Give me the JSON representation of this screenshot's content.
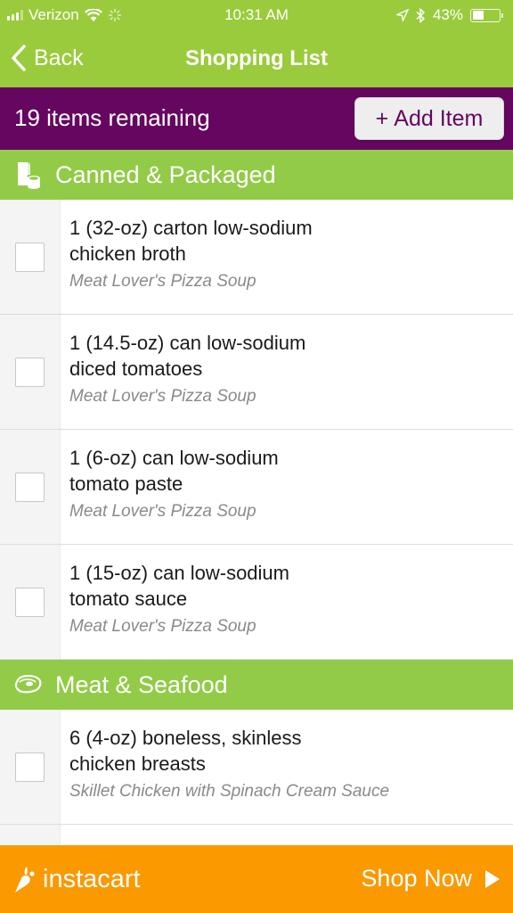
{
  "status_bar": {
    "carrier": "Verizon",
    "time": "10:31 AM",
    "battery_percent": "43%",
    "battery_level": 0.43
  },
  "nav": {
    "back_label": "Back",
    "title": "Shopping List"
  },
  "summary": {
    "remaining_text": "19 items remaining",
    "add_item_label": "Add Item",
    "add_item_icon": "+"
  },
  "sections": [
    {
      "title": "Canned & Packaged",
      "icon": "canned-goods-icon",
      "items": [
        {
          "line1": "1  (32-oz) carton low-sodium",
          "line2": "chicken broth",
          "recipe": "Meat Lover's Pizza Soup",
          "checked": false
        },
        {
          "line1": "1 (14.5-oz) can low-sodium",
          "line2": "diced tomatoes",
          "recipe": "Meat Lover's Pizza Soup",
          "checked": false
        },
        {
          "line1": "1 (6-oz) can low-sodium",
          "line2": "tomato paste",
          "recipe": "Meat Lover's Pizza Soup",
          "checked": false
        },
        {
          "line1": "1 (15-oz) can low-sodium",
          "line2": "tomato sauce",
          "recipe": "Meat Lover's Pizza Soup",
          "checked": false
        }
      ]
    },
    {
      "title": "Meat & Seafood",
      "icon": "steak-icon",
      "items": [
        {
          "line1": "6  (4-oz) boneless, skinless",
          "line2": "chicken breasts",
          "recipe": "Skillet Chicken with Spinach Cream Sauce",
          "checked": false
        }
      ]
    }
  ],
  "footer": {
    "brand": "instacart",
    "cta_label": "Shop Now"
  },
  "colors": {
    "nav_green": "#9acb3c",
    "section_green": "#92cb47",
    "purple": "#650660",
    "orange": "#fa9900"
  }
}
